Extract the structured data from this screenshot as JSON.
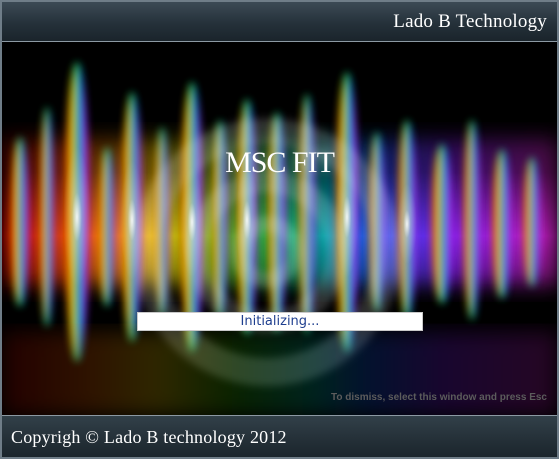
{
  "header": {
    "company": "Lado B Technology"
  },
  "main": {
    "app_title": "MSC FIT",
    "status": "Initializing...",
    "dismiss_hint": "To dismiss, select this window and press Esc",
    "colors": {
      "status_text": "#1f3f8f",
      "bar_background": "#26323a",
      "border": "#6f7d88"
    }
  },
  "footer": {
    "copyright": "Copyrigh © Lado B technology 2012"
  }
}
